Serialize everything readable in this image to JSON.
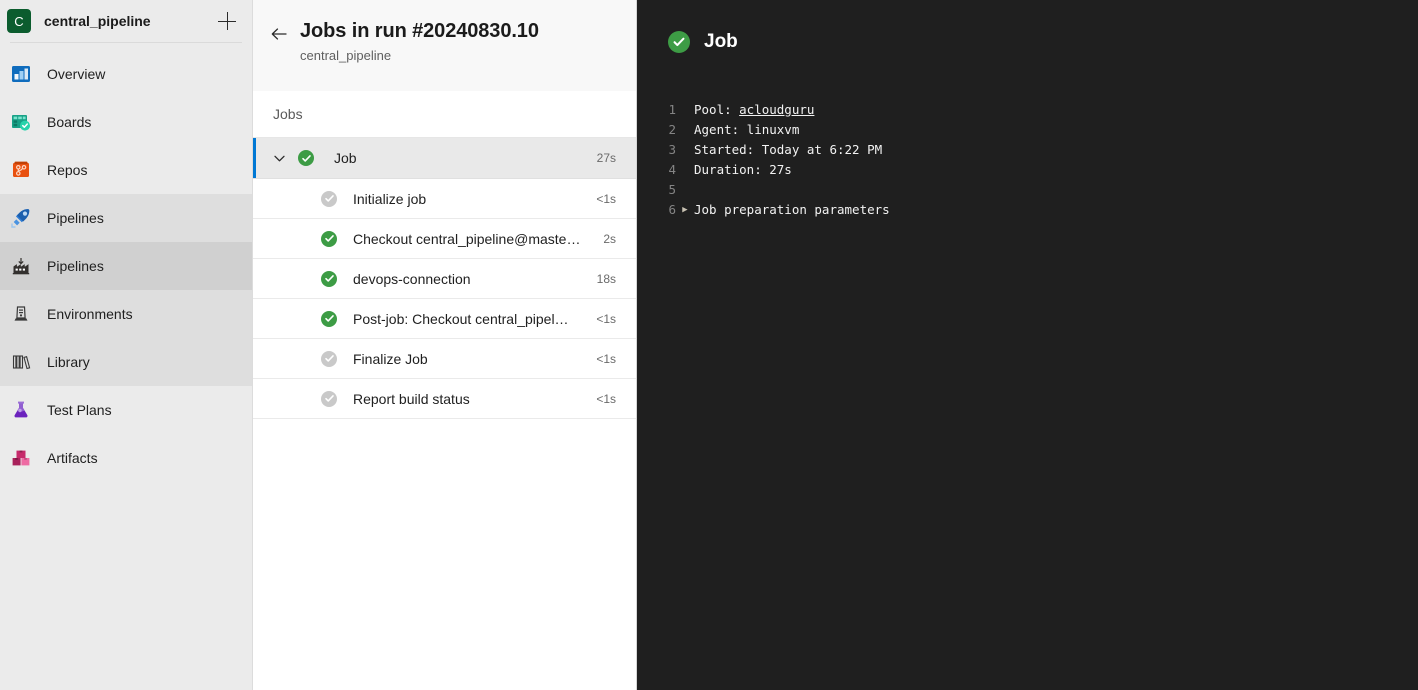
{
  "sidebar": {
    "project": {
      "avatar_letter": "C",
      "name": "central_pipeline",
      "avatar_color": "#0b5c2e",
      "add_label": "+"
    },
    "items": [
      {
        "label": "Overview",
        "icon": "overview-icon",
        "selected": false,
        "group": false
      },
      {
        "label": "Boards",
        "icon": "boards-icon",
        "selected": false,
        "group": false
      },
      {
        "label": "Repos",
        "icon": "repos-icon",
        "selected": false,
        "group": false
      },
      {
        "label": "Pipelines",
        "icon": "pipelines-icon",
        "selected": false,
        "group": true
      },
      {
        "label": "Pipelines",
        "icon": "pipeline-runs-icon",
        "selected": true,
        "group": true
      },
      {
        "label": "Environments",
        "icon": "environments-icon",
        "selected": false,
        "group": true
      },
      {
        "label": "Library",
        "icon": "library-icon",
        "selected": false,
        "group": true
      },
      {
        "label": "Test Plans",
        "icon": "test-plans-icon",
        "selected": false,
        "group": false
      },
      {
        "label": "Artifacts",
        "icon": "artifacts-icon",
        "selected": false,
        "group": false
      }
    ]
  },
  "jobs_panel": {
    "back_icon": "back-arrow-icon",
    "title": "Jobs in run #20240830.10",
    "subtitle": "central_pipeline",
    "section_label": "Jobs",
    "rows": [
      {
        "name": "Job",
        "duration": "27s",
        "status": "ok",
        "type": "parent",
        "expanded": true,
        "selected": true
      },
      {
        "name": "Initialize job",
        "duration": "<1s",
        "status": "skip",
        "type": "child",
        "expanded": false,
        "selected": false
      },
      {
        "name": "Checkout central_pipeline@maste…",
        "duration": "2s",
        "status": "ok",
        "type": "child",
        "expanded": false,
        "selected": false
      },
      {
        "name": "devops-connection",
        "duration": "18s",
        "status": "ok",
        "type": "child",
        "expanded": false,
        "selected": false
      },
      {
        "name": "Post-job: Checkout central_pipel…",
        "duration": "<1s",
        "status": "ok",
        "type": "child",
        "expanded": false,
        "selected": false
      },
      {
        "name": "Finalize Job",
        "duration": "<1s",
        "status": "skip",
        "type": "child",
        "expanded": false,
        "selected": false
      },
      {
        "name": "Report build status",
        "duration": "<1s",
        "status": "skip",
        "type": "child",
        "expanded": false,
        "selected": false
      }
    ]
  },
  "log_panel": {
    "status": "ok",
    "title": "Job",
    "lines": [
      {
        "number": "1",
        "expander": false,
        "pre": "Pool: ",
        "link": "acloudguru",
        "post": ""
      },
      {
        "number": "2",
        "expander": false,
        "pre": "Agent: linuxvm",
        "link": "",
        "post": ""
      },
      {
        "number": "3",
        "expander": false,
        "pre": "Started: Today at 6:22 PM",
        "link": "",
        "post": ""
      },
      {
        "number": "4",
        "expander": false,
        "pre": "Duration: 27s",
        "link": "",
        "post": ""
      },
      {
        "number": "5",
        "expander": false,
        "pre": "",
        "link": "",
        "post": ""
      },
      {
        "number": "6",
        "expander": true,
        "pre": "Job preparation parameters",
        "link": "",
        "post": ""
      }
    ],
    "expander_glyph": "▶"
  },
  "colors": {
    "accent": "#0078d4",
    "success": "#3d9c45",
    "skipped": "#c9c9c9",
    "sidebar_bg": "#ebebeb",
    "log_bg": "#1f1f1f"
  }
}
